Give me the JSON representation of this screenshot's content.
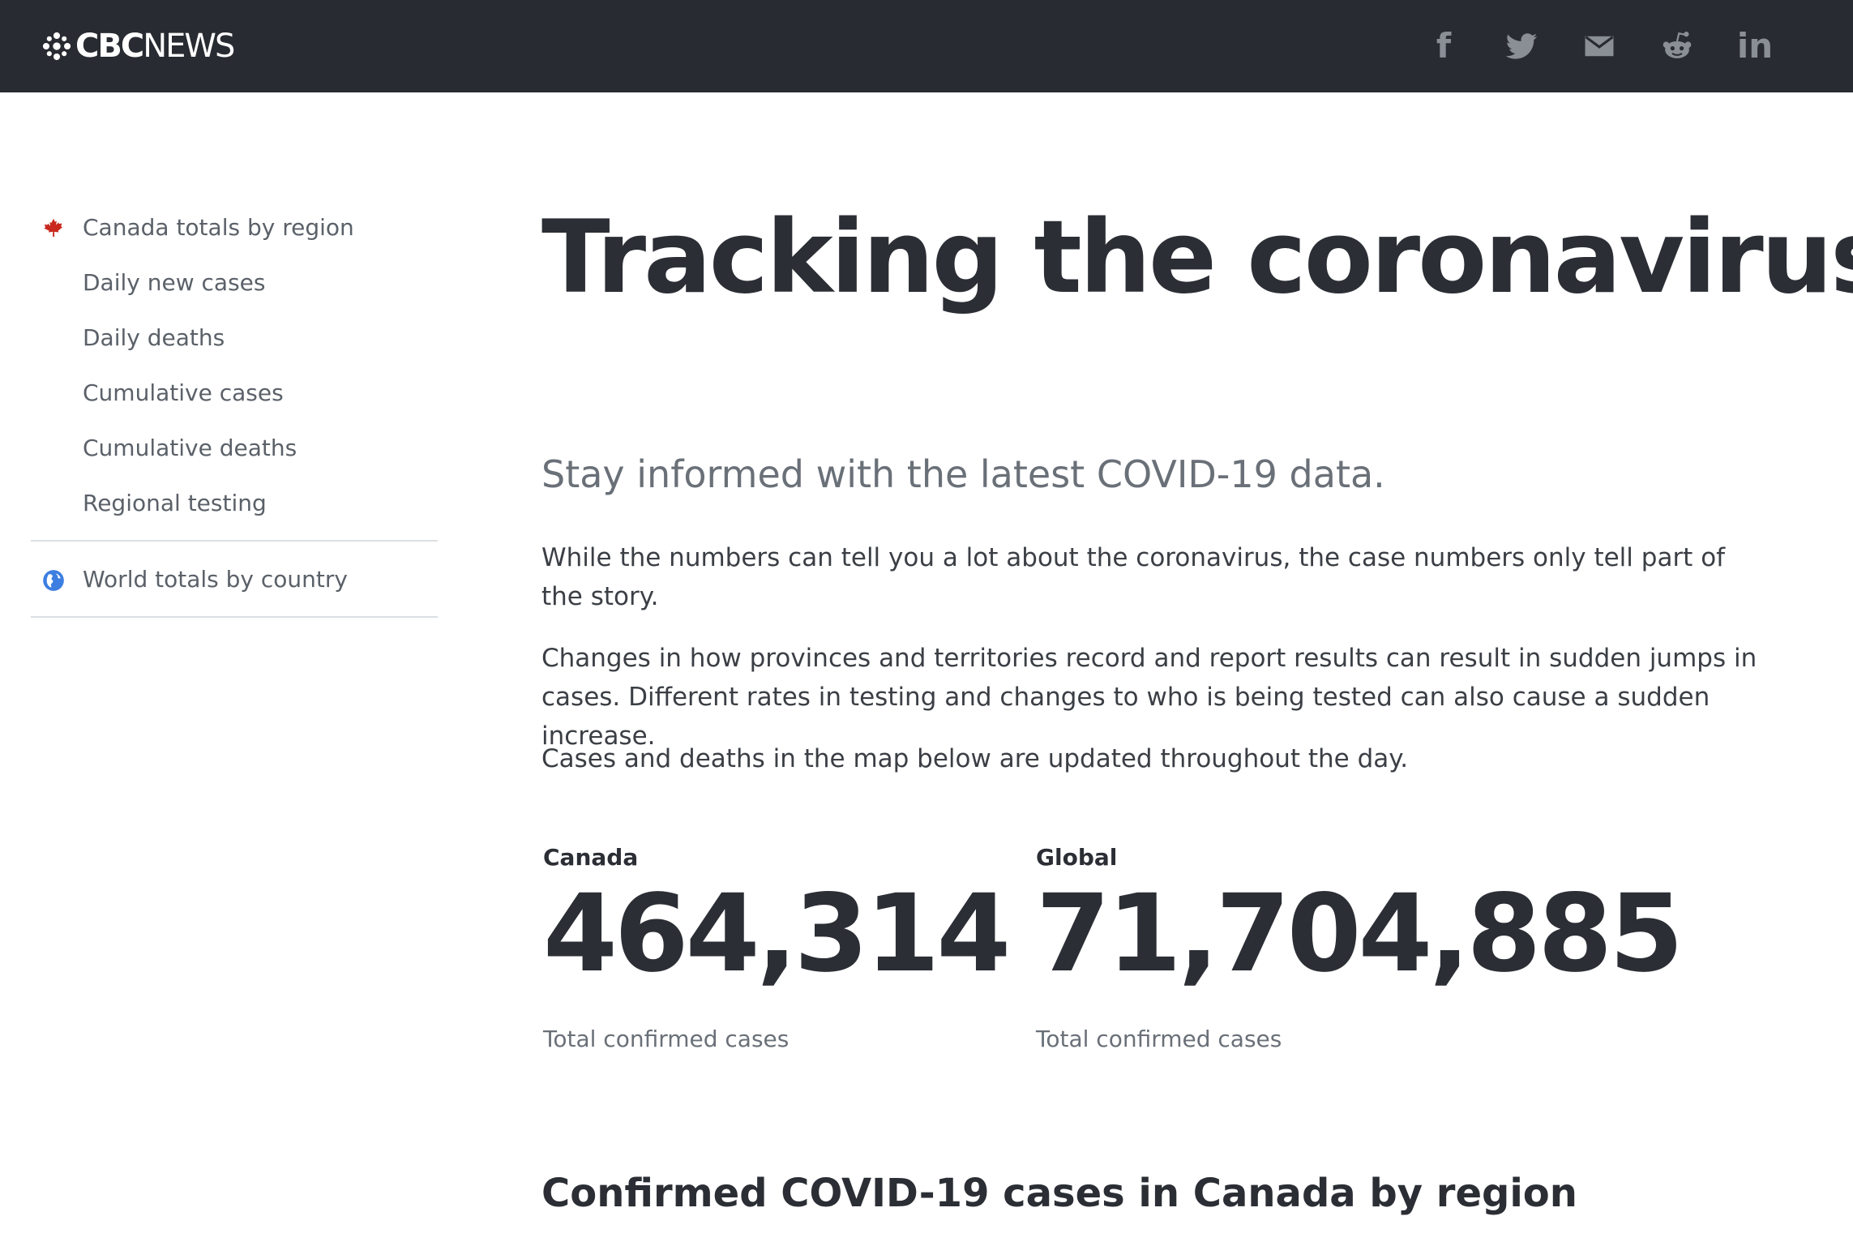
{
  "header": {
    "logo": {
      "cbc": "CBC",
      "news": "NEWS"
    },
    "background": "#282b31",
    "share": [
      {
        "name": "facebook-icon",
        "glyph": "f"
      },
      {
        "name": "twitter-icon"
      },
      {
        "name": "email-icon"
      },
      {
        "name": "reddit-icon"
      },
      {
        "name": "linkedin-icon",
        "glyph": "in"
      }
    ]
  },
  "sidebar": {
    "canada_items": [
      {
        "label": "Canada totals by region",
        "icon": "maple-leaf-icon"
      },
      {
        "label": "Daily new cases"
      },
      {
        "label": "Daily deaths"
      },
      {
        "label": "Cumulative cases"
      },
      {
        "label": "Cumulative deaths"
      },
      {
        "label": "Regional testing"
      }
    ],
    "world_item": {
      "label": "World totals by country",
      "icon": "globe-icon"
    }
  },
  "main": {
    "title": "Tracking the coronavirus",
    "subtitle": "Stay informed with the latest COVID-19 data.",
    "paragraphs": [
      "While the numbers can tell you a lot about the coronavirus, the case numbers only tell part of the story.",
      "Changes in how provinces and territories record and report results can result in sudden jumps in cases. Different rates in testing and changes to who is being tested can also cause a sudden increase.",
      "Cases and deaths in the map below are updated throughout the day."
    ],
    "stats": [
      {
        "label": "Canada",
        "value": "464,314",
        "caption": "Total confirmed cases"
      },
      {
        "label": "Global",
        "value": "71,704,885",
        "caption": "Total confirmed cases"
      }
    ],
    "section_heading": "Confirmed COVID-19 cases in Canada by region"
  },
  "colors": {
    "maple_leaf": "#c8281e",
    "globe": "#3d7ee0",
    "text_primary": "#2b2e34",
    "text_muted": "#6a7078",
    "icon_gray": "#8a8e95"
  }
}
